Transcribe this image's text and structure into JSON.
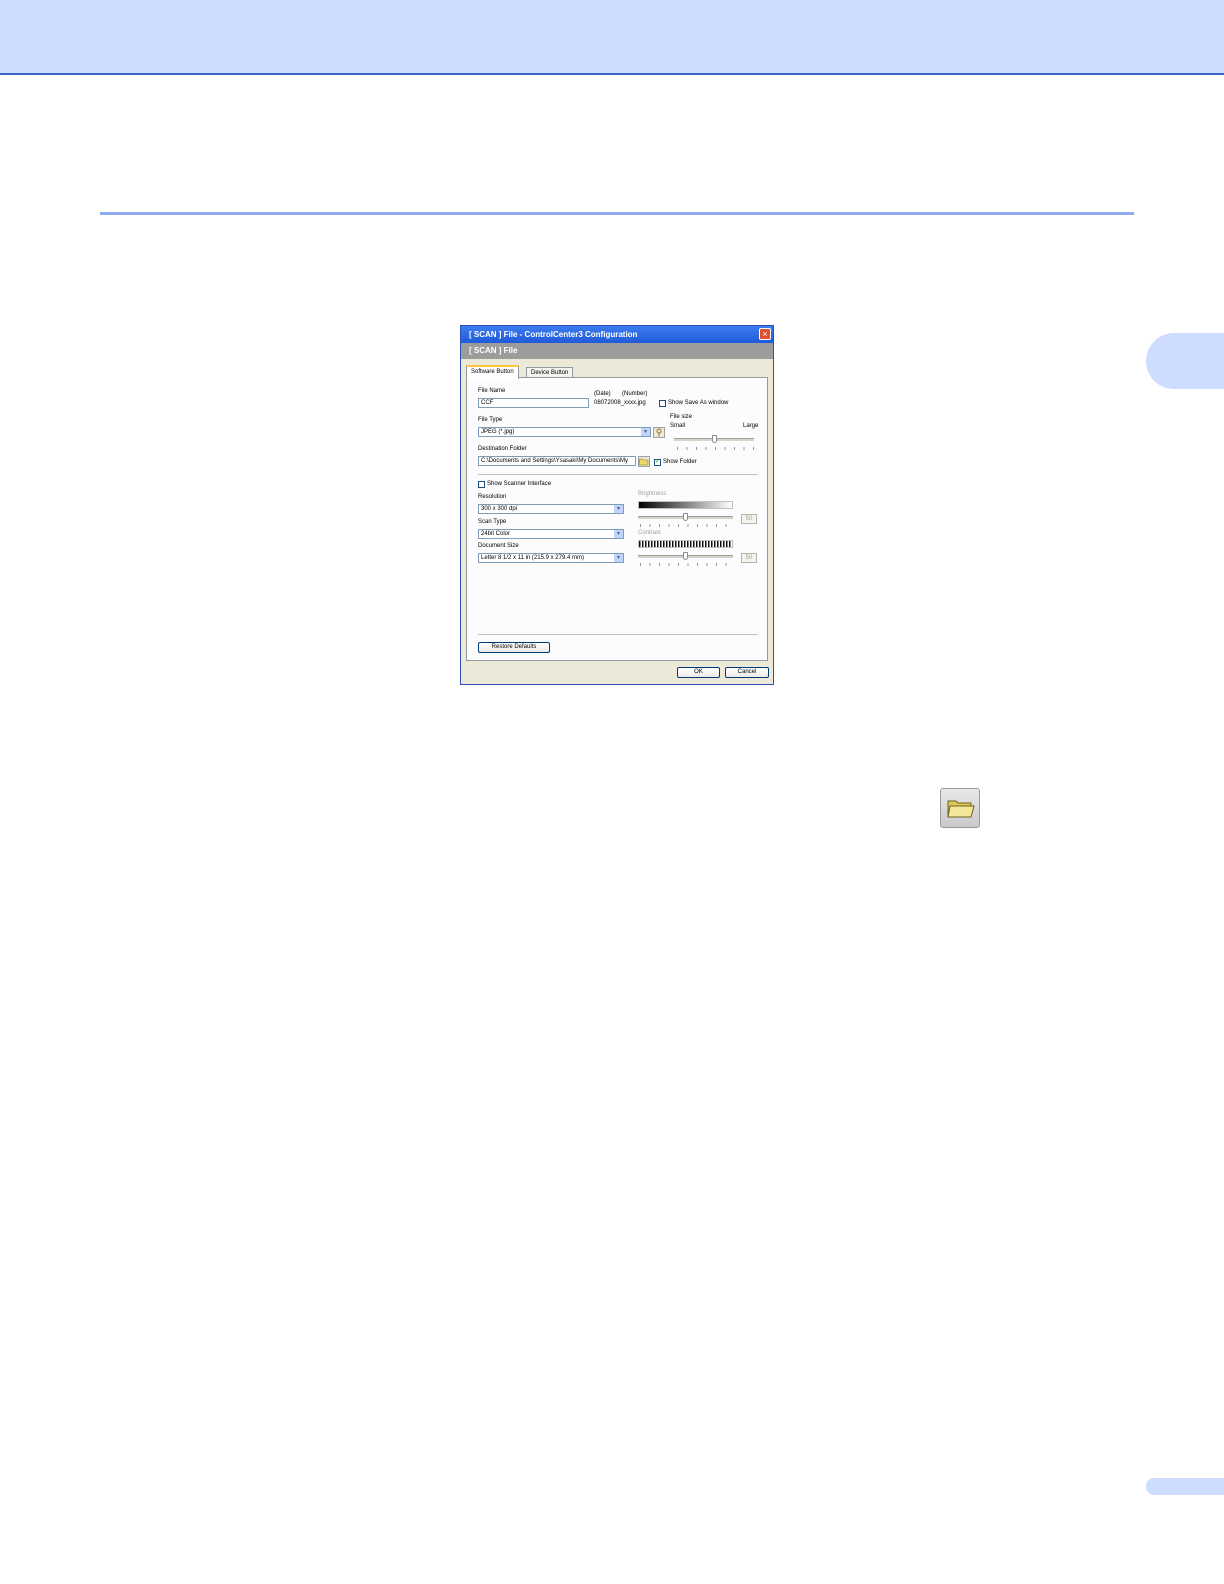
{
  "dialog": {
    "title": "[ SCAN ]   File - ControlCenter3 Configuration",
    "close_symbol": "×",
    "header": "[ SCAN ]   File",
    "tabs": [
      {
        "label": "Software Button",
        "active": true
      },
      {
        "label": "Device Button",
        "active": false
      }
    ],
    "file_name": {
      "label": "File Name",
      "value": "CCF",
      "date_label": "(Date)",
      "number_label": "(Number)",
      "example": "08072008_xxxx.jpg"
    },
    "show_save_as": {
      "label": "Show Save As window",
      "checked": false
    },
    "file_type": {
      "label": "File Type",
      "value": "JPEG (*.jpg)"
    },
    "file_size": {
      "label": "File size",
      "small": "Small",
      "large": "Large",
      "level": 0.5
    },
    "destination": {
      "label": "Destination Folder",
      "value": "C:\\Documents and Settings\\Ysasaki\\My Documents\\My",
      "show_folder": {
        "label": "Show Folder",
        "checked": true,
        "mark": "✓"
      }
    },
    "show_scanner_interface": {
      "label": "Show Scanner Interface",
      "checked": false
    },
    "resolution": {
      "label": "Resolution",
      "value": "300 x 300 dpi"
    },
    "scan_type": {
      "label": "Scan Type",
      "value": "24bit Color"
    },
    "document_size": {
      "label": "Document Size",
      "value": "Letter 8 1/2 x 11 in (215.9 x 279.4 mm)"
    },
    "brightness": {
      "label": "Brightness",
      "value": "50"
    },
    "contrast": {
      "label": "Contrast",
      "value": "50"
    },
    "buttons": {
      "restore": "Restore Defaults",
      "ok": "OK",
      "cancel": "Cancel"
    },
    "dropdown_arrow": "▾"
  },
  "colors": {
    "band": "#cddcff",
    "rule": "#8fabee",
    "titlebar": "#1f5ad8",
    "dialog_bg": "#ece9d8"
  },
  "icons": {
    "browse": "folder-open-icon",
    "file_type_settings": "key-icon"
  }
}
